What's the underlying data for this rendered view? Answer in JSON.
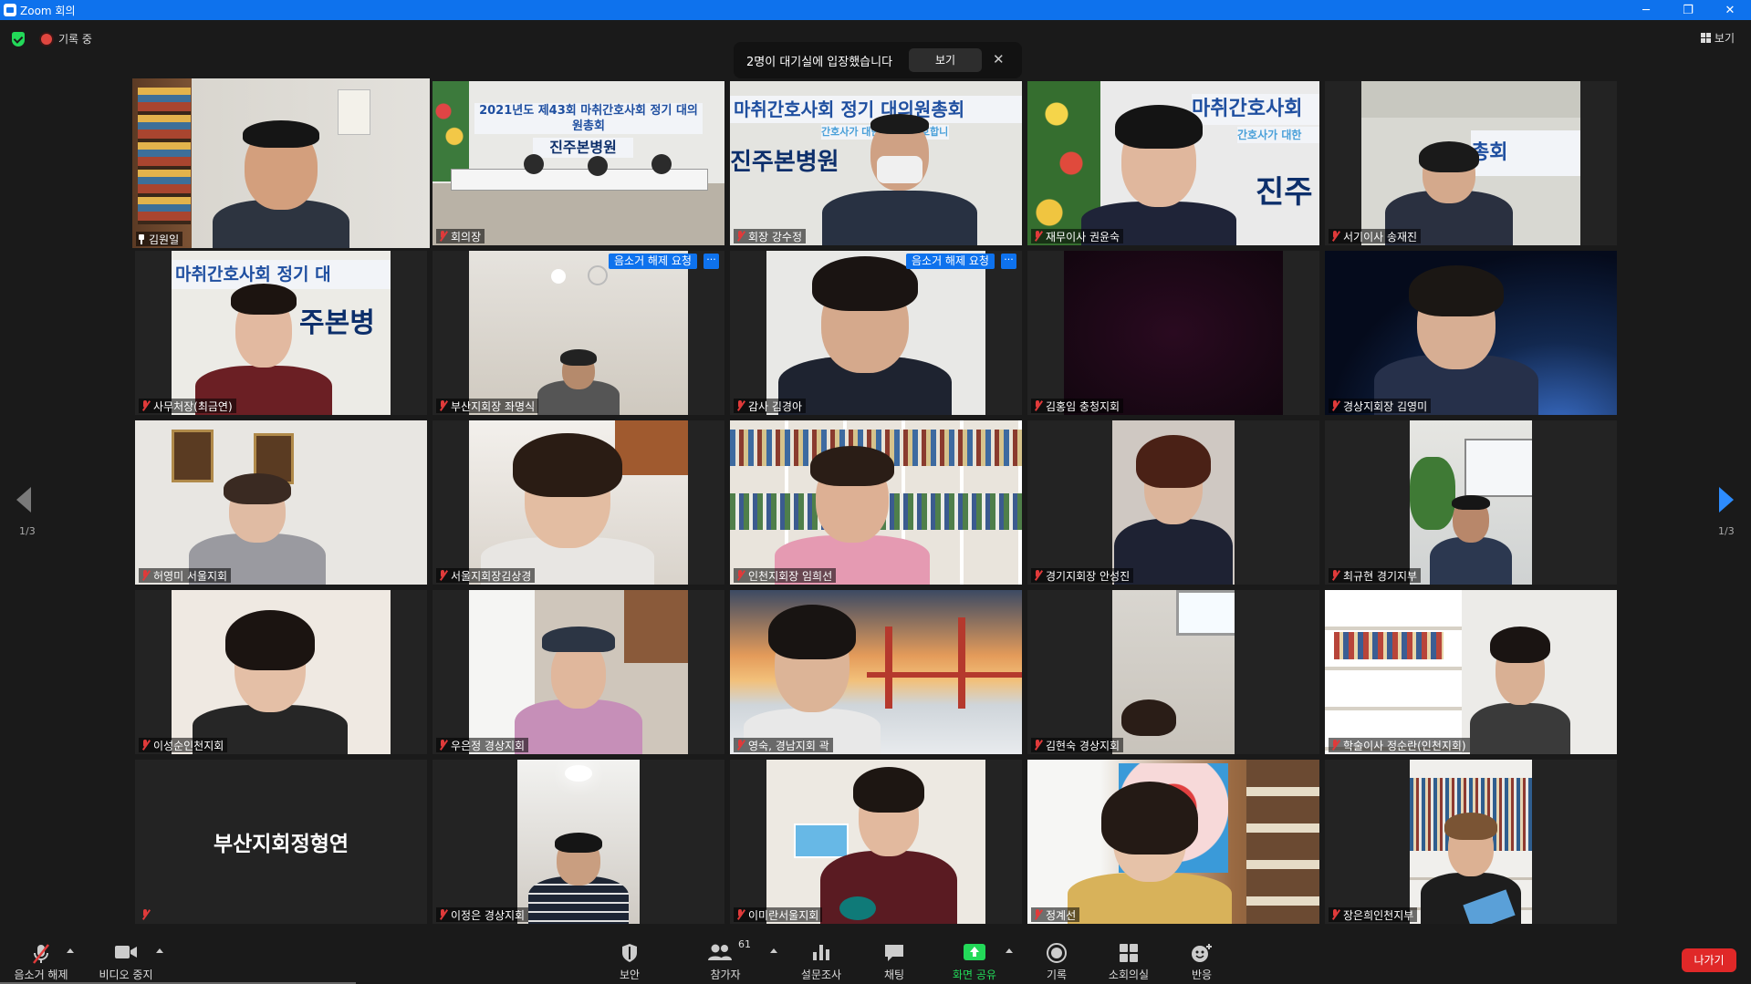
{
  "window": {
    "title": "Zoom 회의",
    "minimize": "─",
    "restore": "❐",
    "close": "✕"
  },
  "status": {
    "recording_label": "기록 중",
    "view_label": "보기"
  },
  "notice": {
    "text": "2명이 대기실에 입장했습니다",
    "view_button": "보기",
    "close": "✕"
  },
  "tiles": [
    {
      "name": "김원일"
    },
    {
      "name": "회의장"
    },
    {
      "name": "회장 강수정"
    },
    {
      "name": "재무이사 권윤숙"
    },
    {
      "name": "서기이사 송재진"
    },
    {
      "name": "사무처장(최금연)"
    },
    {
      "name": "부산지회장 좌명식",
      "request_label": "음소거 해제 요청"
    },
    {
      "name": "감사 김경아",
      "request_label": "음소거 해제 요청"
    },
    {
      "name": "김홍임 충청지회"
    },
    {
      "name": "경상지회장 김영미"
    },
    {
      "name": "허영미 서울지회"
    },
    {
      "name": "서울지회장김상경"
    },
    {
      "name": "인천지회장 임희선"
    },
    {
      "name": "경기지회장 안성진"
    },
    {
      "name": "최규현 경기지부"
    },
    {
      "name": "이성순인천지회"
    },
    {
      "name": "우은정 경상지회"
    },
    {
      "name": "영숙, 경남지회 곽"
    },
    {
      "name": "김현숙 경상지회"
    },
    {
      "name": "학술이사 정순란(인천지회)"
    },
    {
      "name": "",
      "big_name": "부산지회정형연"
    },
    {
      "name": "이정은 경상지회"
    },
    {
      "name": "이미란서울지회"
    },
    {
      "name": "정계선"
    },
    {
      "name": "장은희인천지부"
    }
  ],
  "banners": {
    "b1": "2021년도 제43회 마취간호사회 정기 대의원총회",
    "b1_sign": "진주본병원",
    "b2": "마취간호사회 정기 대의원총회",
    "b2_sub": "간호사가 대한민국을 간호합니다",
    "b2_sign": "진주본병원",
    "b3": "마취간호사회",
    "b3_sub": "간호사가 대한",
    "b3_sign": "진주",
    "b4": "총회",
    "b5": "마취간호사회 정기 대",
    "b5_sign": "주본병"
  },
  "paging": {
    "left": "1/3",
    "right": "1/3"
  },
  "toolbar": {
    "mute_label": "음소거 해제",
    "video_label": "비디오 중지",
    "security_label": "보안",
    "participants_label": "참가자",
    "participants_count": "61",
    "polls_label": "설문조사",
    "chat_label": "채팅",
    "share_label": "화면 공유",
    "record_label": "기록",
    "breakout_label": "소회의실",
    "reactions_label": "반응",
    "leave_label": "나가기"
  },
  "colors": {
    "accent": "#0e72ed",
    "share_green": "#23d959",
    "active_speaker": "#e6e65c",
    "leave_red": "#e02828"
  }
}
